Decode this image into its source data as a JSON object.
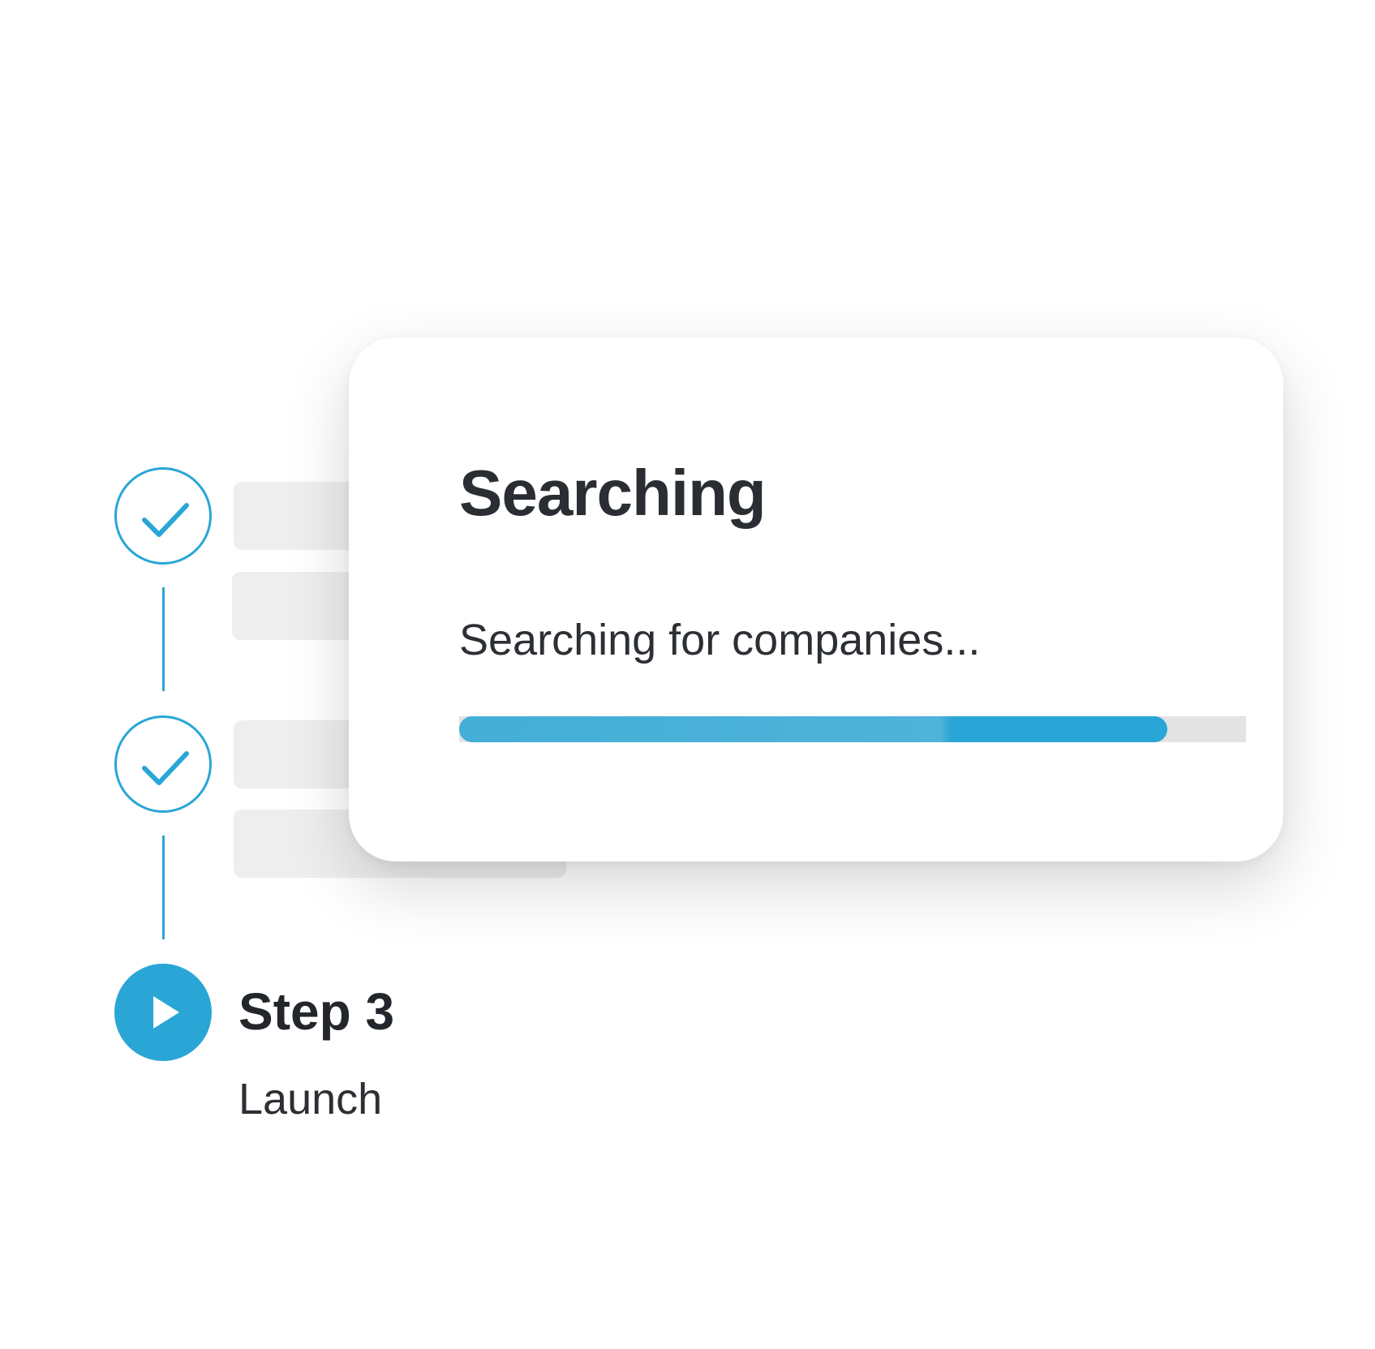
{
  "stepper": {
    "steps": [
      {
        "state": "completed",
        "icon": "check-icon"
      },
      {
        "state": "completed",
        "icon": "check-icon"
      },
      {
        "state": "active",
        "icon": "play-icon",
        "title": "Step 3",
        "subtitle": "Launch"
      }
    ]
  },
  "dialog": {
    "title": "Searching",
    "status": "Searching for companies...",
    "progress": 0.9
  },
  "colors": {
    "accent": "#29a6d6",
    "text": "#2a2d32",
    "track": "#e3e3e3",
    "placeholder": "#eeeeee"
  }
}
